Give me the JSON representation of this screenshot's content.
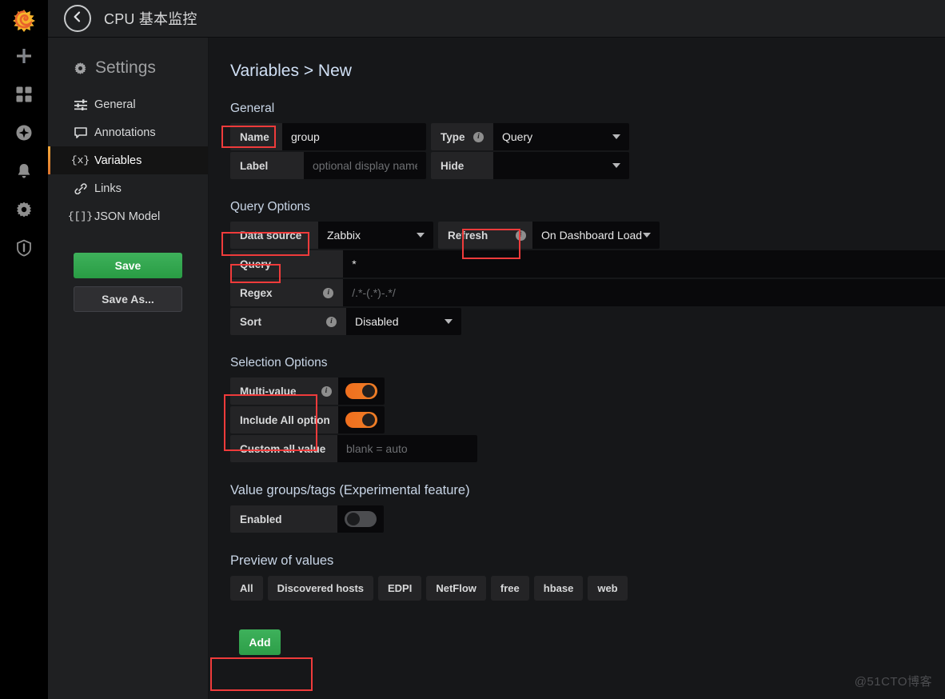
{
  "header": {
    "dashboard_title": "CPU 基本监控",
    "back_icon": "arrow-left-circle-icon",
    "logo_icon": "grafana-logo-icon"
  },
  "rail": {
    "items": [
      {
        "name": "create-add-icon",
        "icon": "plus-icon"
      },
      {
        "name": "dashboards-icon",
        "icon": "grid-squares-icon"
      },
      {
        "name": "explore-icon",
        "icon": "compass-icon"
      },
      {
        "name": "alerting-icon",
        "icon": "bell-icon"
      },
      {
        "name": "configuration-icon",
        "icon": "gear-icon"
      },
      {
        "name": "server-admin-icon",
        "icon": "shield-icon"
      }
    ]
  },
  "settings": {
    "title": "Settings",
    "title_icon": "gear-icon",
    "nav": [
      {
        "label": "General",
        "icon": "sliders-icon",
        "active": false
      },
      {
        "label": "Annotations",
        "icon": "comment-icon",
        "active": false
      },
      {
        "label": "Variables",
        "icon": "braces-x-icon",
        "active": true
      },
      {
        "label": "Links",
        "icon": "link-icon",
        "active": false
      },
      {
        "label": "JSON Model",
        "icon": "braces-brackets-icon",
        "active": false
      }
    ],
    "save_label": "Save",
    "save_as_label": "Save As..."
  },
  "main": {
    "page_title": "Variables > New",
    "general": {
      "section_title": "General",
      "name_label": "Name",
      "name_value": "group",
      "label_label": "Label",
      "label_placeholder": "optional display name",
      "type_label": "Type",
      "type_value": "Query",
      "hide_label": "Hide",
      "hide_value": ""
    },
    "query_options": {
      "section_title": "Query Options",
      "datasource_label": "Data source",
      "datasource_value": "Zabbix",
      "refresh_label": "Refresh",
      "refresh_value": "On Dashboard Load",
      "query_label": "Query",
      "query_value": "*",
      "regex_label": "Regex",
      "regex_placeholder": "/.*-(.*)-.*/",
      "sort_label": "Sort",
      "sort_value": "Disabled"
    },
    "selection_options": {
      "section_title": "Selection Options",
      "multi_value_label": "Multi-value",
      "multi_value_on": true,
      "include_all_label": "Include All option",
      "include_all_on": true,
      "custom_all_label": "Custom all value",
      "custom_all_placeholder": "blank = auto"
    },
    "value_groups": {
      "section_title": "Value groups/tags (Experimental feature)",
      "enabled_label": "Enabled",
      "enabled_on": false
    },
    "preview": {
      "section_title": "Preview of values",
      "values": [
        "All",
        "Discovered hosts",
        "EDPI",
        "NetFlow",
        "free",
        "hbase",
        "web"
      ]
    },
    "add_label": "Add"
  },
  "watermark": "@51CTO博客",
  "colors": {
    "accent_orange": "#eb7b18",
    "highlight_red": "#ef3b3b",
    "save_green": "#299c44",
    "panel_bg": "#161719",
    "label_bg": "#242426",
    "input_bg": "#09090b"
  }
}
